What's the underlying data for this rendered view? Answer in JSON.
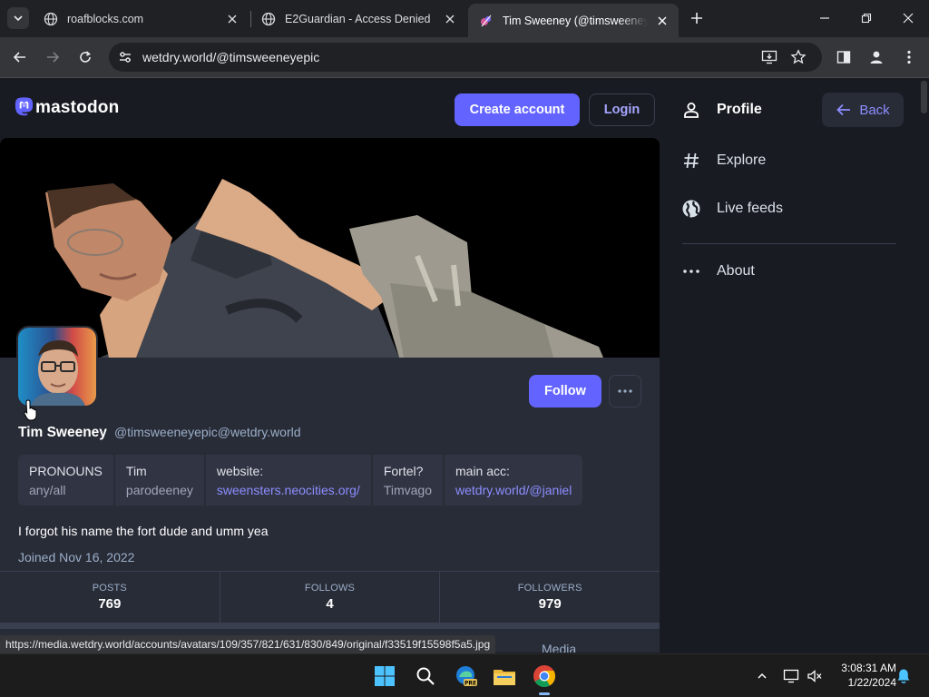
{
  "browser": {
    "tabs": [
      {
        "title": "roafblocks.com",
        "active": false
      },
      {
        "title": "E2Guardian - Access Denied",
        "active": false
      },
      {
        "title": "Tim Sweeney (@timsweeneyepic",
        "active": true
      }
    ],
    "url": "wetdry.world/@timsweeneyepic",
    "status_url": "https://media.wetdry.world/accounts/avatars/109/357/821/631/830/849/original/f33519f15598f5a5.jpg"
  },
  "header": {
    "logo_text": "mastodon",
    "create_account": "Create account",
    "login": "Login"
  },
  "profile": {
    "display_name": "Tim Sweeney",
    "acct": "@timsweeneyepic@wetdry.world",
    "follow": "Follow",
    "fields": [
      {
        "name": "PRONOUNS",
        "value": "any/all",
        "link": false
      },
      {
        "name": "Tim",
        "value": "parodeeney",
        "link": false
      },
      {
        "name": "website:",
        "value": "sweensters.neocities.org/",
        "link": true
      },
      {
        "name": "Fortel?",
        "value": "Timvago",
        "link": false
      },
      {
        "name": "main acc:",
        "value": "wetdry.world/@janiel",
        "link": true
      }
    ],
    "bio": "I forgot his name the fort dude and umm yea",
    "joined": "Joined Nov 16, 2022",
    "stats": [
      {
        "label": "POSTS",
        "value": "769"
      },
      {
        "label": "FOLLOWS",
        "value": "4"
      },
      {
        "label": "FOLLOWERS",
        "value": "979"
      }
    ],
    "tab_media": "Media"
  },
  "nav": {
    "profile": "Profile",
    "explore": "Explore",
    "live_feeds": "Live feeds",
    "about": "About",
    "back": "Back"
  },
  "taskbar": {
    "time": "3:08:31 AM",
    "date": "1/22/2024"
  },
  "colors": {
    "accent": "#6364ff",
    "link": "#8c8dff",
    "panel": "#282c37",
    "background": "#191b22"
  }
}
